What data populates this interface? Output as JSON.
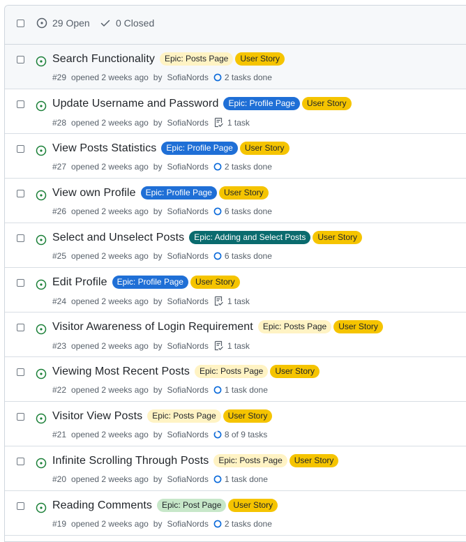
{
  "header": {
    "open_label": "29 Open",
    "closed_label": "0 Closed"
  },
  "colors": {
    "open_green": "#1a7f37",
    "task_blue": "#0969da",
    "meta_gray": "#57606a"
  },
  "label_styles": {
    "Epic: Posts Page": {
      "bg": "#fff3c4",
      "fg": "#1f2328"
    },
    "Epic: Profile Page": {
      "bg": "#1f6fd6",
      "fg": "#ffffff"
    },
    "Epic: Adding and Select Posts": {
      "bg": "#0a6b6e",
      "fg": "#ffffff"
    },
    "Epic: Post Page": {
      "bg": "#c7e7c9",
      "fg": "#1f2328"
    },
    "User Story": {
      "bg": "#f5c400",
      "fg": "#1f2328"
    }
  },
  "issues": [
    {
      "title": "Search Functionality",
      "labels": [
        "Epic: Posts Page",
        "User Story"
      ],
      "number": "#29",
      "opened": "opened 2 weeks ago",
      "by": "by",
      "author": "SofiaNords",
      "task_icon": "progress-circle-icon",
      "tasks": "2 tasks done"
    },
    {
      "title": "Update Username and Password",
      "labels": [
        "Epic: Profile Page",
        "User Story"
      ],
      "number": "#28",
      "opened": "opened 2 weeks ago",
      "by": "by",
      "author": "SofiaNords",
      "task_icon": "checklist-icon",
      "tasks": "1 task"
    },
    {
      "title": "View Posts Statistics",
      "labels": [
        "Epic: Profile Page",
        "User Story"
      ],
      "number": "#27",
      "opened": "opened 2 weeks ago",
      "by": "by",
      "author": "SofiaNords",
      "task_icon": "progress-circle-icon",
      "tasks": "2 tasks done"
    },
    {
      "title": "View own Profile",
      "labels": [
        "Epic: Profile Page",
        "User Story"
      ],
      "number": "#26",
      "opened": "opened 2 weeks ago",
      "by": "by",
      "author": "SofiaNords",
      "task_icon": "progress-circle-icon",
      "tasks": "6 tasks done"
    },
    {
      "title": "Select and Unselect Posts",
      "labels": [
        "Epic: Adding and Select Posts",
        "User Story"
      ],
      "number": "#25",
      "opened": "opened 2 weeks ago",
      "by": "by",
      "author": "SofiaNords",
      "task_icon": "progress-circle-icon",
      "tasks": "6 tasks done"
    },
    {
      "title": "Edit Profile",
      "labels": [
        "Epic: Profile Page",
        "User Story"
      ],
      "number": "#24",
      "opened": "opened 2 weeks ago",
      "by": "by",
      "author": "SofiaNords",
      "task_icon": "checklist-icon",
      "tasks": "1 task"
    },
    {
      "title": "Visitor Awareness of Login Requirement",
      "labels": [
        "Epic: Posts Page",
        "User Story"
      ],
      "number": "#23",
      "opened": "opened 2 weeks ago",
      "by": "by",
      "author": "SofiaNords",
      "task_icon": "checklist-icon",
      "tasks": "1 task"
    },
    {
      "title": "Viewing Most Recent Posts",
      "labels": [
        "Epic: Posts Page",
        "User Story"
      ],
      "number": "#22",
      "opened": "opened 2 weeks ago",
      "by": "by",
      "author": "SofiaNords",
      "task_icon": "progress-circle-icon",
      "tasks": "1 task done"
    },
    {
      "title": "Visitor View Posts",
      "labels": [
        "Epic: Posts Page",
        "User Story"
      ],
      "number": "#21",
      "opened": "opened 2 weeks ago",
      "by": "by",
      "author": "SofiaNords",
      "task_icon": "partial-progress-icon",
      "tasks": "8 of 9 tasks"
    },
    {
      "title": "Infinite Scrolling Through Posts",
      "labels": [
        "Epic: Posts Page",
        "User Story"
      ],
      "number": "#20",
      "opened": "opened 2 weeks ago",
      "by": "by",
      "author": "SofiaNords",
      "task_icon": "progress-circle-icon",
      "tasks": "1 task done"
    },
    {
      "title": "Reading Comments",
      "labels": [
        "Epic: Post Page",
        "User Story"
      ],
      "number": "#19",
      "opened": "opened 2 weeks ago",
      "by": "by",
      "author": "SofiaNords",
      "task_icon": "progress-circle-icon",
      "tasks": "2 tasks done"
    }
  ]
}
